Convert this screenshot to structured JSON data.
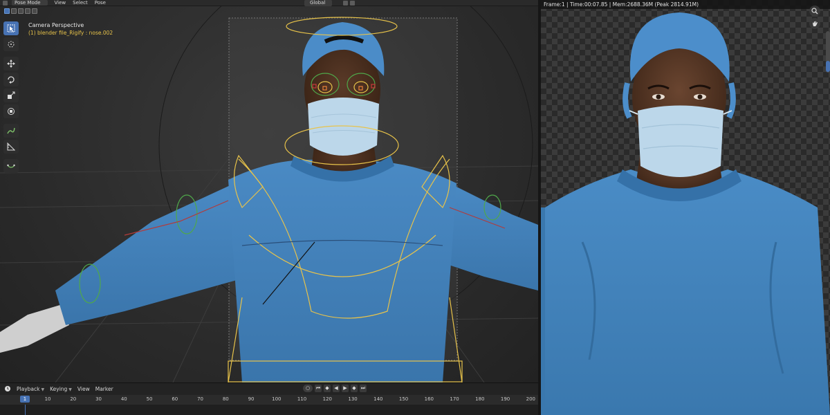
{
  "viewport": {
    "mode_label": "Pose Mode",
    "menu": [
      "View",
      "Select",
      "Pose"
    ],
    "transform_orientation": "Global",
    "view_label": "Camera Perspective",
    "active_object": "(1) blender file_Rigify : nose.002",
    "tools": [
      {
        "name": "select-box",
        "icon": "cursor-select-icon",
        "active": true
      },
      {
        "name": "cursor",
        "icon": "3d-cursor-icon",
        "active": false
      },
      {
        "name": "move",
        "icon": "move-arrows-icon",
        "active": false
      },
      {
        "name": "rotate",
        "icon": "rotate-icon",
        "active": false
      },
      {
        "name": "scale",
        "icon": "scale-icon",
        "active": false
      },
      {
        "name": "transform",
        "icon": "transform-icon",
        "active": false
      },
      {
        "name": "annotate",
        "icon": "annotate-pen-icon",
        "active": false
      },
      {
        "name": "measure",
        "icon": "measure-ruler-icon",
        "active": false
      },
      {
        "name": "relax",
        "icon": "pose-relax-icon",
        "active": false
      }
    ]
  },
  "render": {
    "stats": "Frame:1 | Time:00:07.85 | Mem:2688.36M (Peak 2814.91M)"
  },
  "timeline": {
    "menu": [
      "Playback",
      "Keying",
      "View",
      "Marker"
    ],
    "current_frame": "1",
    "ticks": [
      "10",
      "20",
      "30",
      "40",
      "50",
      "60",
      "70",
      "80",
      "90",
      "100",
      "110",
      "120",
      "130",
      "140",
      "150",
      "160",
      "170",
      "180",
      "190",
      "200"
    ]
  },
  "colors": {
    "accent": "#4772b3",
    "bone_yellow": "#e8c34a",
    "bone_green": "#4fa84a",
    "scrubs_blue": "#3f7fb8",
    "mask_blue": "#bcd7ea"
  }
}
